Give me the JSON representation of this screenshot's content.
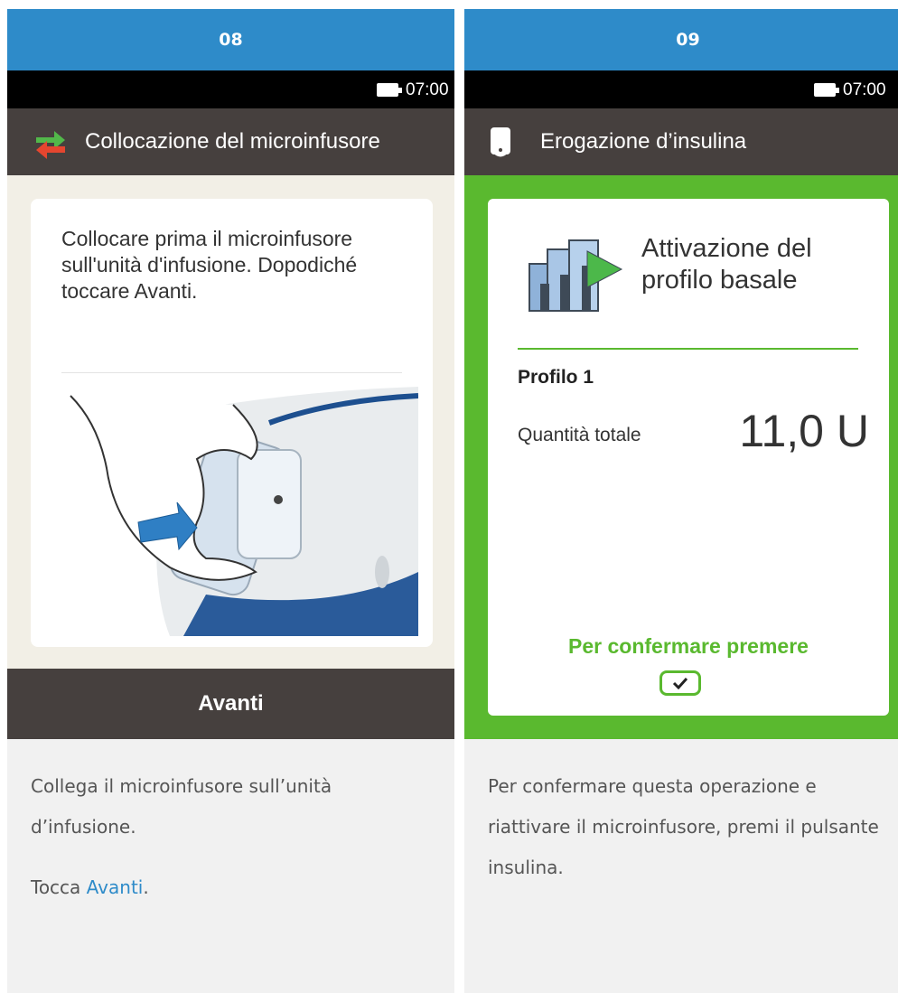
{
  "left": {
    "step_number": "08",
    "status_time": "07:00",
    "screen_title": "Collocazione del microinfusore",
    "message": "Collocare prima il microinfusore sull'unità d'infusione. Dopodiché toccare Avanti.",
    "next_button_label": "Avanti",
    "description": {
      "line1": "Collega il microinfusore sull’unità d’infusione.",
      "line2_prefix": "Tocca ",
      "line2_link": "Avanti",
      "line2_suffix": "."
    }
  },
  "right": {
    "step_number": "09",
    "status_time": "07:00",
    "screen_title": "Erogazione d’insulina",
    "card_title_line1": "Attivazione del",
    "card_title_line2": "profilo basale",
    "profile_name": "Profilo 1",
    "total_label": "Quantità totale",
    "total_value": "11,0 U",
    "confirm_hint": "Per confermare premere",
    "description": "Per confermare questa operazione e riattivare il microinfusore, premi il pulsante insulina."
  },
  "icons": {
    "swap": "swap-arrows-icon",
    "pump": "insulin-pump-icon",
    "basal_profile": "basal-profile-play-icon",
    "battery": "battery-icon",
    "check": "check-icon"
  },
  "colors": {
    "step_header": "#2e8bc9",
    "title_bar": "#46403e",
    "confirm_green": "#5ab92f",
    "background_beige": "#f2efe6",
    "link": "#2e8bc9"
  }
}
